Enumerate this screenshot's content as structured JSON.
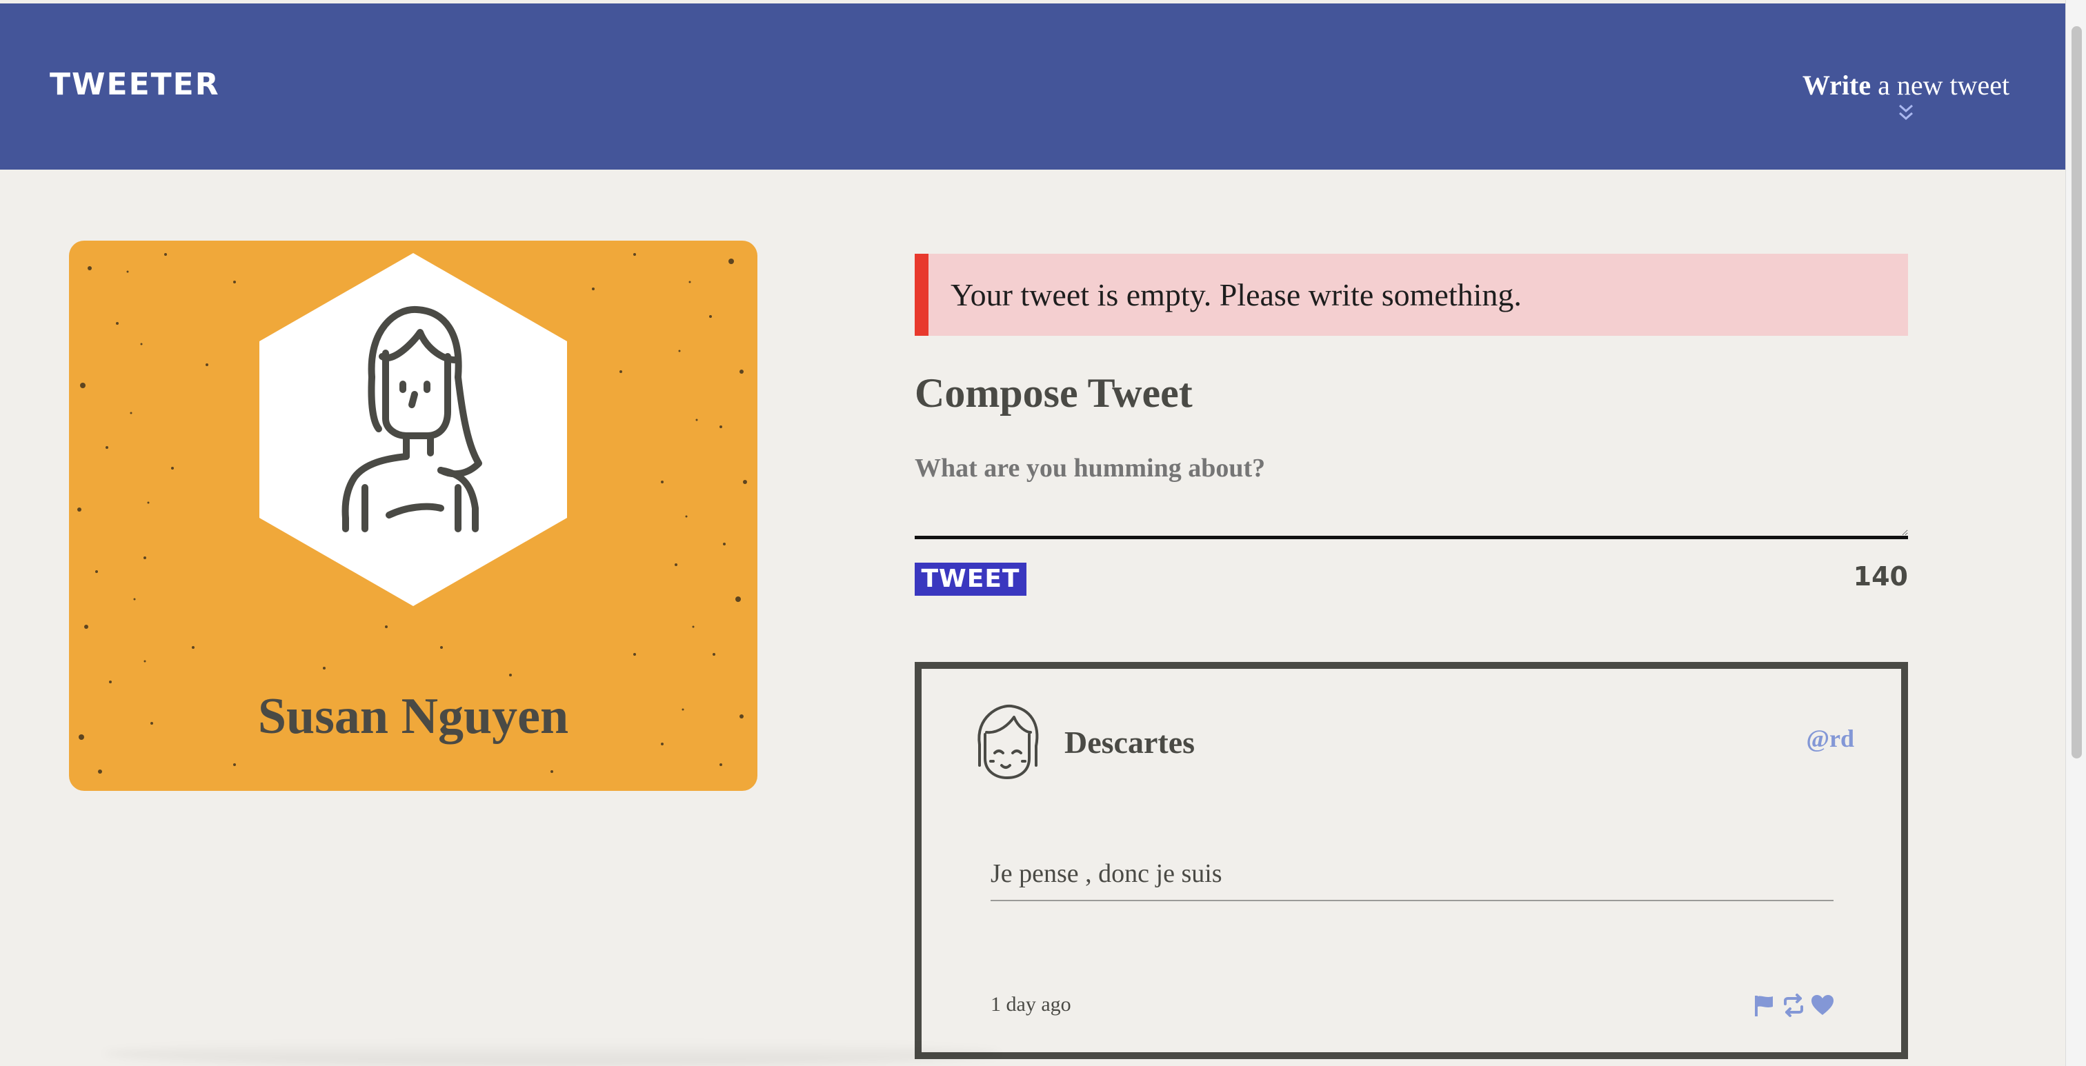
{
  "nav": {
    "brand": "TWEETER",
    "compose_toggle": {
      "bold": "Write",
      "rest": " a new tweet",
      "icon": "double-chevron-down-icon"
    }
  },
  "profile": {
    "name": "Susan Nguyen",
    "avatar_icon": "woman-avatar-icon",
    "card_color": "#f0a83a"
  },
  "compose": {
    "error": "Your tweet is empty. Please write something.",
    "title": "Compose Tweet",
    "placeholder": "What are you humming about?",
    "button_label": "TWEET",
    "counter": "140"
  },
  "tweets": [
    {
      "author": "Descartes",
      "handle": "@rd",
      "content": "Je pense , donc je suis",
      "timestamp": "1 day ago",
      "avatar_icon": "smiling-avatar-icon",
      "actions": [
        "flag-icon",
        "retweet-icon",
        "heart-icon"
      ]
    }
  ],
  "colors": {
    "nav": "#445599",
    "error_accent": "#e8392d",
    "error_bg": "#f4cfd0",
    "button": "#3a37bf",
    "link": "#8397d6"
  }
}
